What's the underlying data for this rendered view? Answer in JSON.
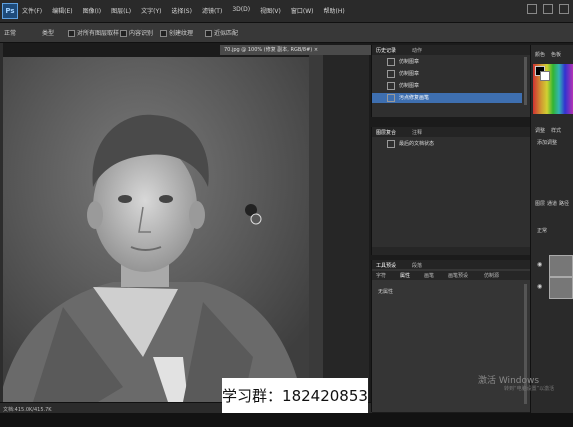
{
  "app": {
    "logo": "Ps"
  },
  "menu": {
    "items": [
      "文件(F)",
      "编辑(E)",
      "图像(I)",
      "图层(L)",
      "文字(Y)",
      "选择(S)",
      "滤镜(T)",
      "3D(D)",
      "视图(V)",
      "窗口(W)",
      "帮助(H)"
    ]
  },
  "options": {
    "brush": "正常",
    "mode": "类型",
    "sample_all": "对所有图层取样",
    "content_aware": "内容识别",
    "create_texture": "创建纹理",
    "proximity": "近似匹配"
  },
  "document": {
    "tab": "70.jpg @ 100% (修复 副本, RGB/8#) ×"
  },
  "status": {
    "text": "文档:415.0K/415.7K"
  },
  "history_panel": {
    "tabs": [
      "历史记录",
      "动作"
    ],
    "rows": [
      {
        "label": "仿制图章",
        "selected": false
      },
      {
        "label": "仿制图章",
        "selected": false
      },
      {
        "label": "仿制图章",
        "selected": false
      },
      {
        "label": "污点修复画笔",
        "selected": true
      }
    ]
  },
  "channels_panel": {
    "tabs": [
      "图层复合",
      "注释"
    ],
    "row": "最后的文档状态"
  },
  "properties_panel": {
    "tabs": [
      "工具预设",
      "段落",
      "字符",
      "属性",
      "画笔",
      "画笔预设",
      "仿制源"
    ],
    "label": "无属性"
  },
  "right_strip": {
    "tabs": [
      "颜色",
      "色板",
      "调整",
      "样式",
      "图层",
      "通道",
      "路径"
    ],
    "add_adjustment": "添加调整",
    "blend": "正常"
  },
  "watermark": {
    "qq_text": "学习群：182420853",
    "activate": "激活 Windows",
    "activate_sub": "转到“电脑设置”以激活"
  }
}
